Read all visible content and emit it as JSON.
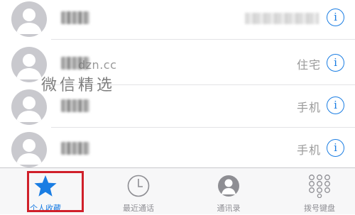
{
  "contacts": [
    {
      "type": ""
    },
    {
      "type": "住宅"
    },
    {
      "type": "手机"
    },
    {
      "type": "手机"
    }
  ],
  "info_glyph": "i",
  "watermark": {
    "site": "dzn.cc",
    "brand": "微信精选"
  },
  "tabs": [
    {
      "label": "个人收藏",
      "icon": "star-icon",
      "active": true
    },
    {
      "label": "最近通话",
      "icon": "clock-icon",
      "active": false
    },
    {
      "label": "通讯录",
      "icon": "contacts-icon",
      "active": false
    },
    {
      "label": "拨号键盘",
      "icon": "keypad-icon",
      "active": false
    }
  ],
  "colors": {
    "accent": "#1a7de3",
    "highlight": "#d0202a",
    "avatar": "#c9c9ce"
  }
}
